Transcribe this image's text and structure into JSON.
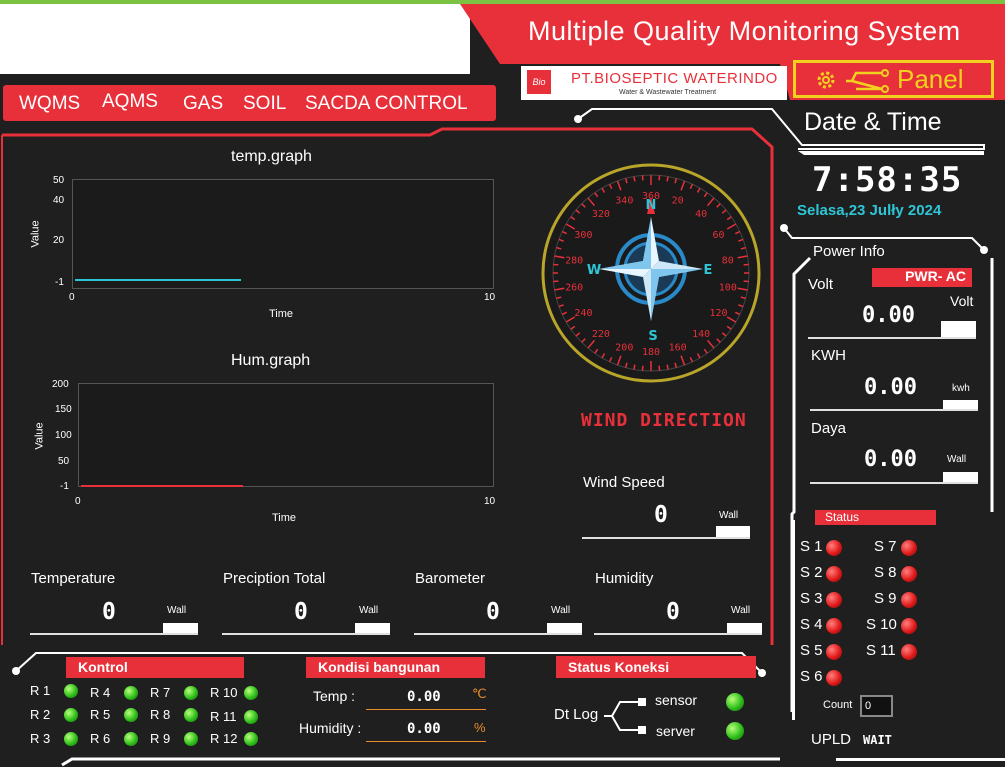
{
  "header": {
    "title": "Multiple Quality Monitoring System",
    "company": "PT.BIOSEPTIC WATERINDO",
    "company_sub": "Water & Wastewater Treatment",
    "logo_mark": "Bio",
    "panel_label": "Panel"
  },
  "nav": [
    "WQMS",
    "AQMS",
    "GAS",
    "SOIL",
    "SACDA CONTROL"
  ],
  "datetime": {
    "heading": "Date & Time",
    "time": "7:58:35",
    "date": "Selasa,23 Julły 2024"
  },
  "temp_graph": {
    "title": "temp.graph",
    "ylabel": "Value",
    "xlabel": "Time",
    "yticks": [
      "50",
      "40",
      "20",
      "-1"
    ],
    "xticks": [
      "0",
      "10"
    ]
  },
  "hum_graph": {
    "title": "Hum.graph",
    "ylabel": "Value",
    "xlabel": "Time",
    "yticks": [
      "200",
      "150",
      "100",
      "50",
      "-1"
    ],
    "xticks": [
      "0",
      "10"
    ]
  },
  "compass": {
    "degrees": [
      "360",
      "20",
      "40",
      "60",
      "80",
      "100",
      "120",
      "140",
      "160",
      "180",
      "200",
      "220",
      "240",
      "260",
      "280",
      "300",
      "320",
      "340"
    ],
    "cardinals": {
      "n": "N",
      "e": "E",
      "s": "S",
      "w": "W"
    },
    "label": "WIND DIRECTION"
  },
  "wind": {
    "label": "Wind Speed",
    "value": "0",
    "unit": "Wall"
  },
  "sensors": [
    {
      "label": "Temperature",
      "value": "0",
      "unit": "Wall"
    },
    {
      "label": "Preciption Total",
      "value": "0",
      "unit": "Wall"
    },
    {
      "label": "Barometer",
      "value": "0",
      "unit": "Wall"
    },
    {
      "label": "Humidity",
      "value": "0",
      "unit": "Wall"
    }
  ],
  "power": {
    "heading": "Power Info",
    "badge": "PWR- AC",
    "volt": {
      "label": "Volt",
      "value": "0.00",
      "unit": "Volt"
    },
    "kwh": {
      "label": "KWH",
      "value": "0.00",
      "unit": "kwh"
    },
    "daya": {
      "label": "Daya",
      "value": "0.00",
      "unit": "Wall"
    }
  },
  "status": {
    "heading": "Status",
    "items": [
      "S 1",
      "S 7",
      "S 2",
      "S 8",
      "S 3",
      "S 9",
      "S 4",
      "S 10",
      "S 5",
      "S 11",
      "S 6"
    ],
    "count_label": "Count",
    "count_value": "0",
    "upld_label": "UPLD",
    "upld_status": "WAIT"
  },
  "kontrol": {
    "heading": "Kontrol",
    "relays": [
      "R 1",
      "R 4",
      "R 7",
      "R 10",
      "R 2",
      "R 5",
      "R 8",
      "R 11",
      "R 3",
      "R 6",
      "R 9",
      "R 12"
    ]
  },
  "kondisi": {
    "heading": "Kondisi bangunan",
    "temp_label": "Temp :",
    "temp_value": "0.00",
    "temp_unit": "℃",
    "hum_label": "Humidity :",
    "hum_value": "0.00",
    "hum_unit": "%"
  },
  "koneksi": {
    "heading": "Status Koneksi",
    "dtlog": "Dt Log",
    "sensor": "sensor",
    "server": "server"
  },
  "colors": {
    "accent": "#e8303a",
    "panel_bg": "#1f1f1f",
    "led_on": "#2fbf1a",
    "led_red": "#e21a1a",
    "gold": "#f0d21e",
    "cyan": "#2ec6d6"
  }
}
